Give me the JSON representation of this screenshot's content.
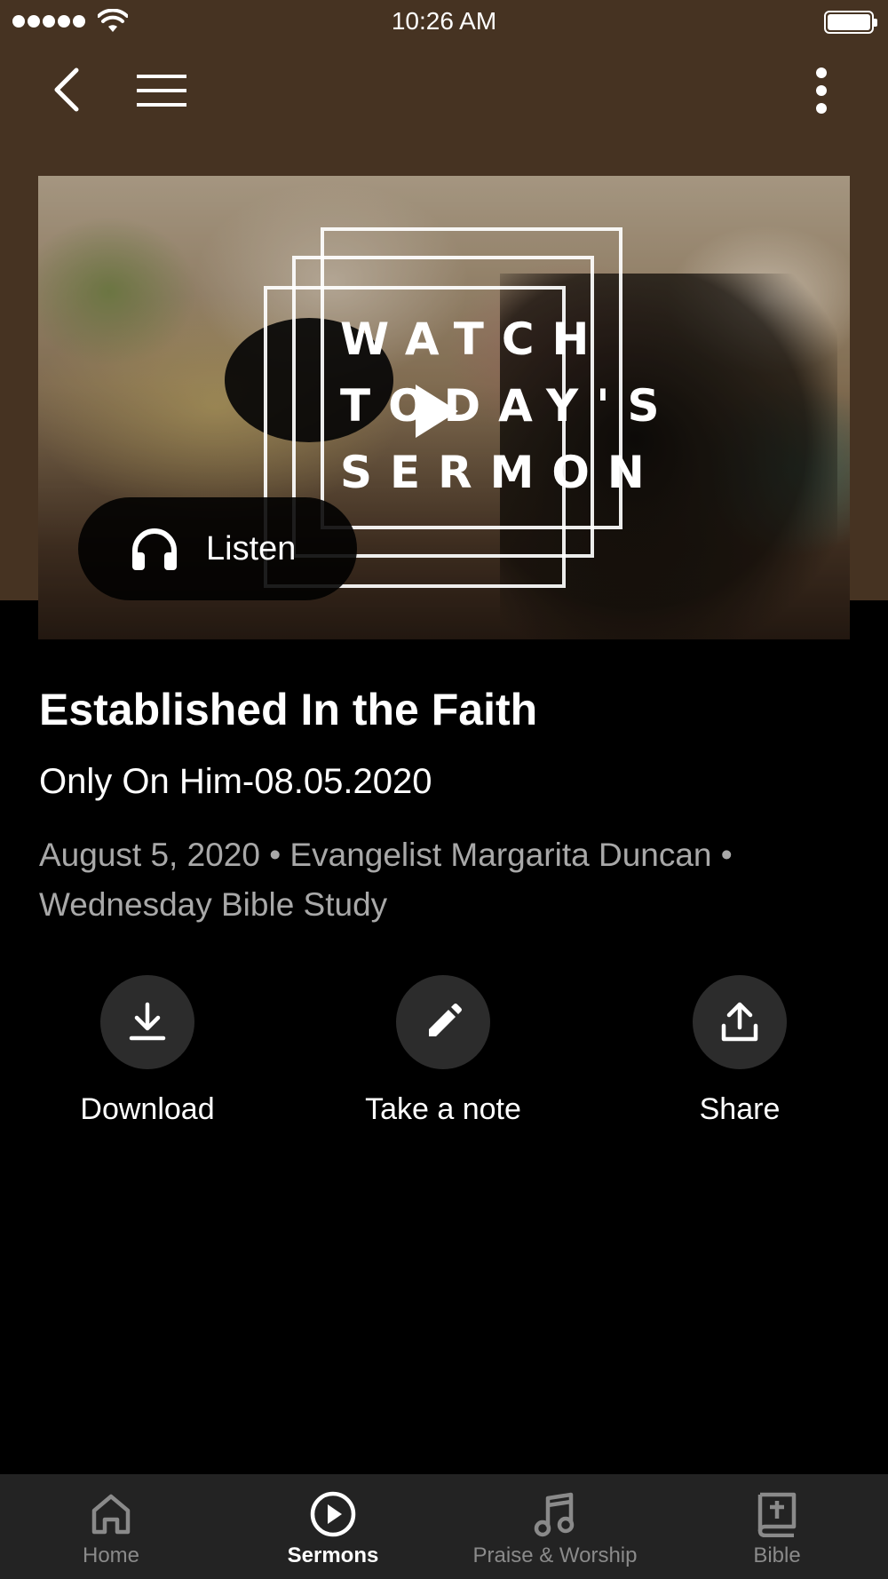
{
  "status_bar": {
    "time": "10:26 AM"
  },
  "video": {
    "overlay_lines": [
      "WATCH",
      "TODAY'S",
      "SERMON"
    ],
    "listen_label": "Listen"
  },
  "sermon": {
    "title": "Established In the Faith",
    "subtitle": "Only On Him-08.05.2020",
    "meta": "August 5, 2020 • Evangelist Margarita Duncan • Wednesday Bible Study"
  },
  "actions": [
    {
      "label": "Download",
      "icon": "download-icon"
    },
    {
      "label": "Take a note",
      "icon": "pencil-icon"
    },
    {
      "label": "Share",
      "icon": "share-icon"
    }
  ],
  "tabs": [
    {
      "label": "Home",
      "icon": "home-icon",
      "active": false
    },
    {
      "label": "Sermons",
      "icon": "play-circle-icon",
      "active": true
    },
    {
      "label": "Praise & Worship",
      "icon": "music-note-icon",
      "active": false
    },
    {
      "label": "Bible",
      "icon": "bible-icon",
      "active": false
    }
  ],
  "colors": {
    "header_brown": "#463322",
    "background": "#000000",
    "tab_bar": "#232323",
    "action_circle": "#2c2c2c",
    "muted_text": "#a8a8a8"
  }
}
